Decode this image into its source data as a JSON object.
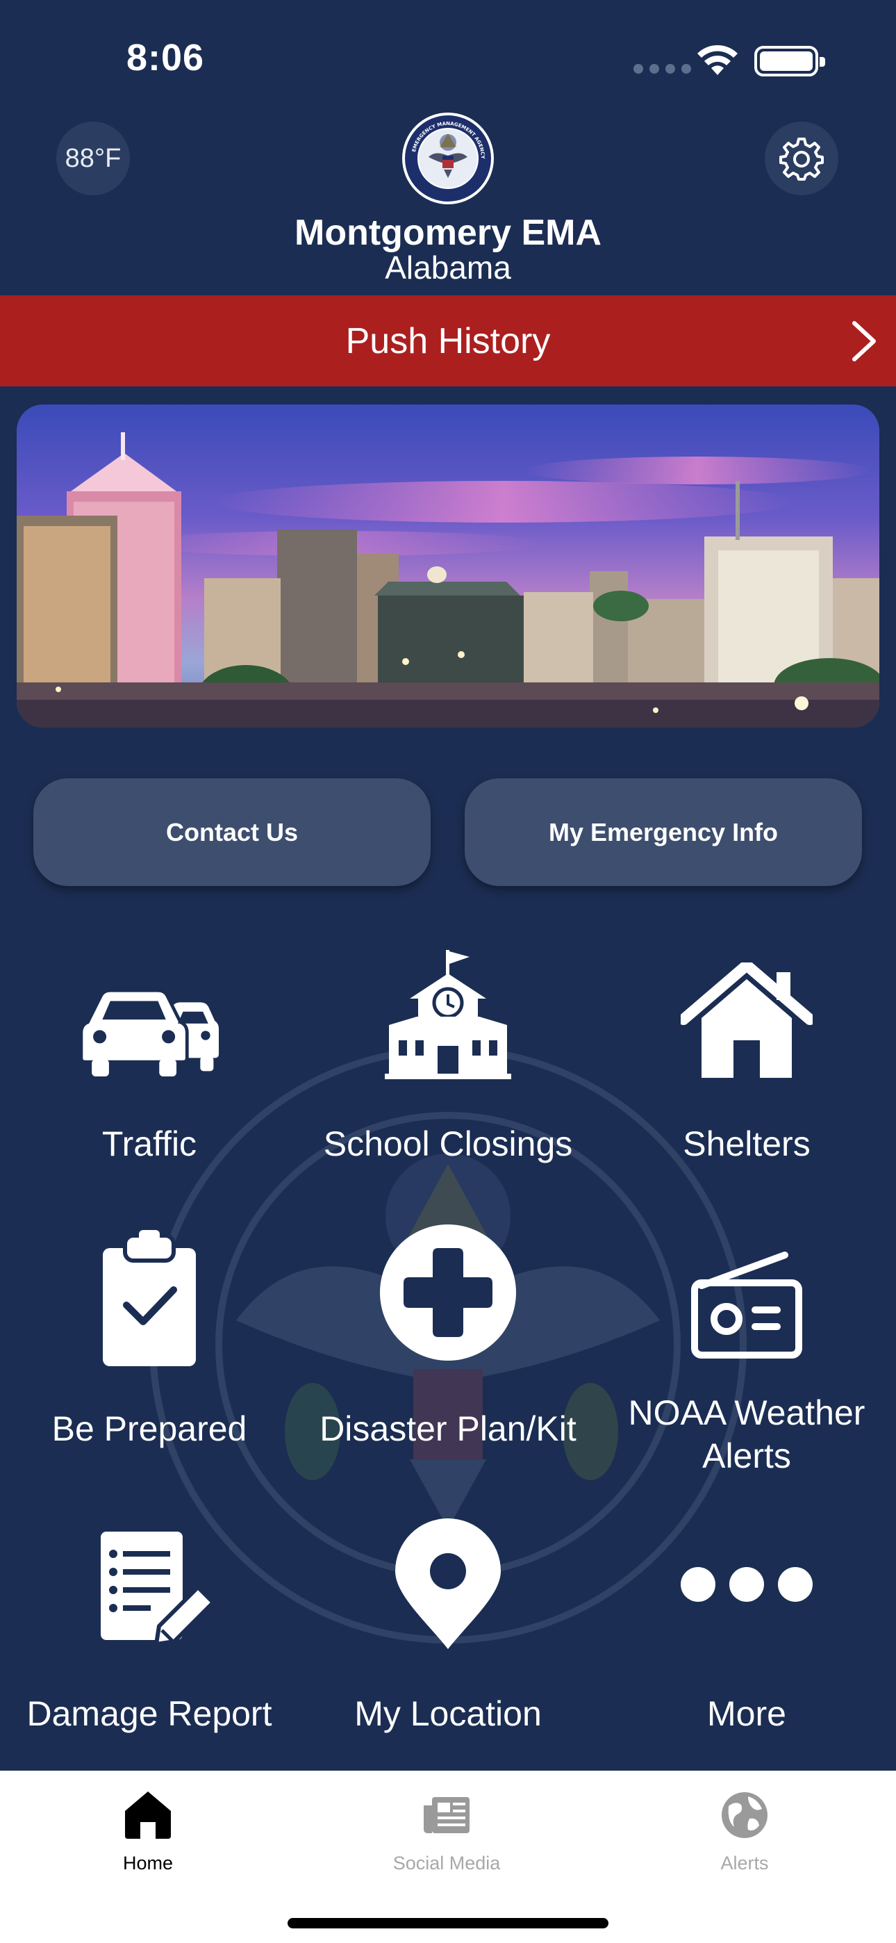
{
  "status_bar": {
    "time": "8:06"
  },
  "header": {
    "temperature": "88°F",
    "title": "Montgomery EMA",
    "subtitle": "Alabama",
    "seal_text": "EMERGENCY MANAGEMENT AGENCY · MONTGOMERY CITY / COUNTY"
  },
  "push_history": {
    "label": "Push History"
  },
  "buttons": {
    "contact": "Contact Us",
    "emergency_info": "My Emergency Info"
  },
  "grid": [
    {
      "label": "Traffic",
      "icon": "car-icon"
    },
    {
      "label": "School Closings",
      "icon": "school-icon"
    },
    {
      "label": "Shelters",
      "icon": "house-icon"
    },
    {
      "label": "Be Prepared",
      "icon": "clipboard-check-icon"
    },
    {
      "label": "Disaster Plan/Kit",
      "icon": "medical-cross-icon"
    },
    {
      "label": "NOAA Weather Alerts",
      "icon": "radio-icon"
    },
    {
      "label": "Damage Report",
      "icon": "report-pencil-icon"
    },
    {
      "label": "My Location",
      "icon": "map-pin-icon"
    },
    {
      "label": "More",
      "icon": "ellipsis-icon"
    }
  ],
  "tabs": [
    {
      "label": "Home",
      "icon": "home-icon",
      "active": true
    },
    {
      "label": "Social Media",
      "icon": "newspaper-icon",
      "active": false
    },
    {
      "label": "Alerts",
      "icon": "globe-icon",
      "active": false
    }
  ],
  "colors": {
    "background": "#1b2d52",
    "push_bar": "#ac1f1f",
    "button": "#3d4e6e",
    "tab_bar": "#ffffff"
  }
}
